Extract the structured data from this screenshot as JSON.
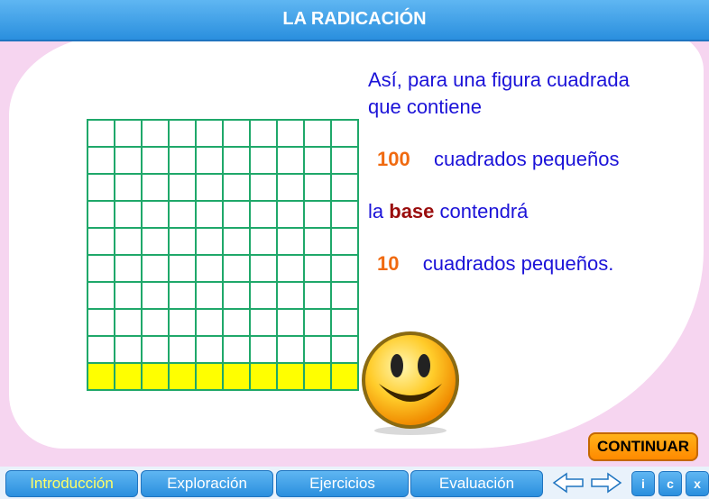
{
  "header": {
    "title": "LA RADICACIÓN"
  },
  "content": {
    "line1": "Así, para una figura cuadrada",
    "line2": "que  contiene",
    "num_total": "100",
    "squares_label_1": "cuadrados pequeños",
    "base_prefix": "la",
    "base_word": "base",
    "base_suffix": "contendrá",
    "num_base": "10",
    "squares_label_2": "cuadrados pequeños."
  },
  "grid": {
    "rows": 10,
    "cols": 10,
    "highlighted_row": 10,
    "line_color": "#1fa86a",
    "highlight_color": "#ffff00"
  },
  "buttons": {
    "continue_label": "CONTINUAR"
  },
  "nav": {
    "tabs": [
      {
        "label": "Introducción",
        "active": true
      },
      {
        "label": "Exploración"
      },
      {
        "label": "Ejercicios"
      },
      {
        "label": "Evaluación"
      }
    ],
    "prev_icon": "arrow-left-icon",
    "next_icon": "arrow-right-icon",
    "info_label": "i",
    "credits_label": "c",
    "close_label": "x"
  },
  "colors": {
    "accent": "#2a8fde",
    "text_blue": "#1b12d8",
    "number_orange": "#f06a10",
    "base_red": "#9a0d0d",
    "button_orange": "#ff9a00"
  }
}
